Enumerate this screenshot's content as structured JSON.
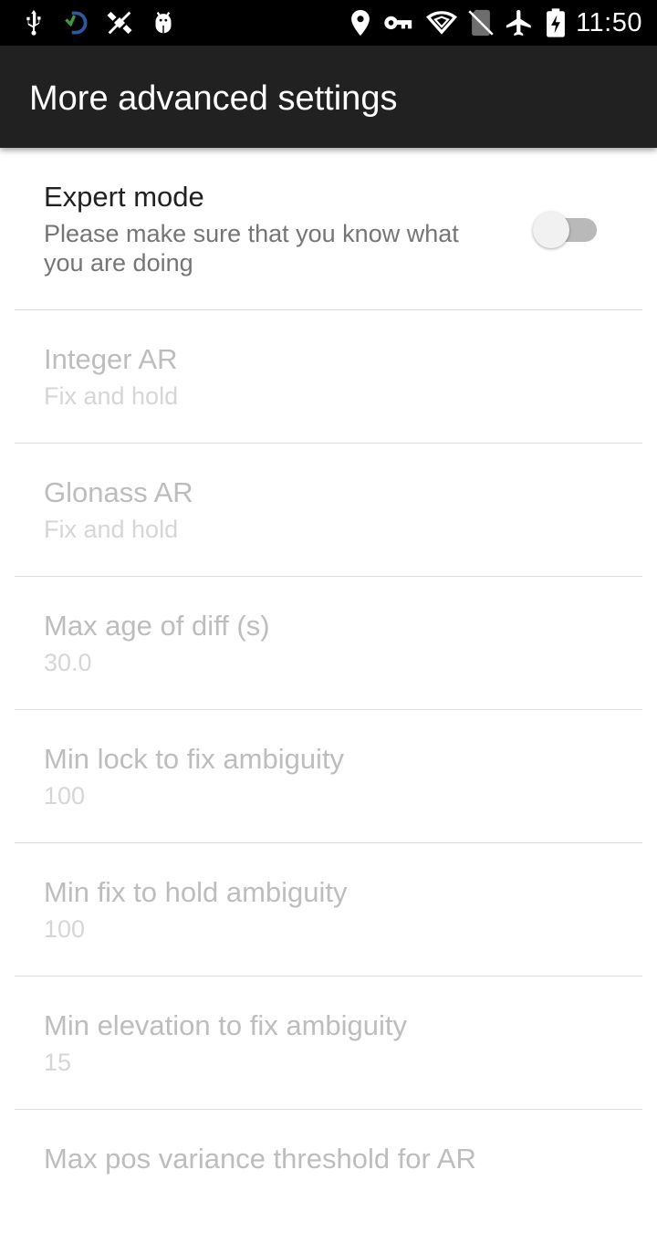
{
  "status_bar": {
    "time": "11:50",
    "icons_left": [
      "usb-icon",
      "sync-app-icon",
      "satellite-off-icon",
      "android-debug-icon"
    ],
    "icons_right": [
      "location-icon",
      "vpn-key-icon",
      "wifi-icon",
      "no-sim-icon",
      "airplane-mode-icon",
      "battery-charging-icon"
    ]
  },
  "app_bar": {
    "title": "More advanced settings"
  },
  "settings": [
    {
      "title": "Expert mode",
      "summary": "Please make sure that you know what you are doing",
      "switch_on": false,
      "enabled": true
    },
    {
      "title": "Integer AR",
      "summary": "Fix and hold",
      "enabled": false
    },
    {
      "title": "Glonass AR",
      "summary": "Fix and hold",
      "enabled": false
    },
    {
      "title": "Max age of diff (s)",
      "summary": "30.0",
      "enabled": false
    },
    {
      "title": "Min lock to fix ambiguity",
      "summary": "100",
      "enabled": false
    },
    {
      "title": "Min fix to hold ambiguity",
      "summary": "100",
      "enabled": false
    },
    {
      "title": "Min elevation to fix ambiguity",
      "summary": "15",
      "enabled": false
    },
    {
      "title": "Max pos variance threshold for AR",
      "summary": "",
      "enabled": false
    }
  ]
}
